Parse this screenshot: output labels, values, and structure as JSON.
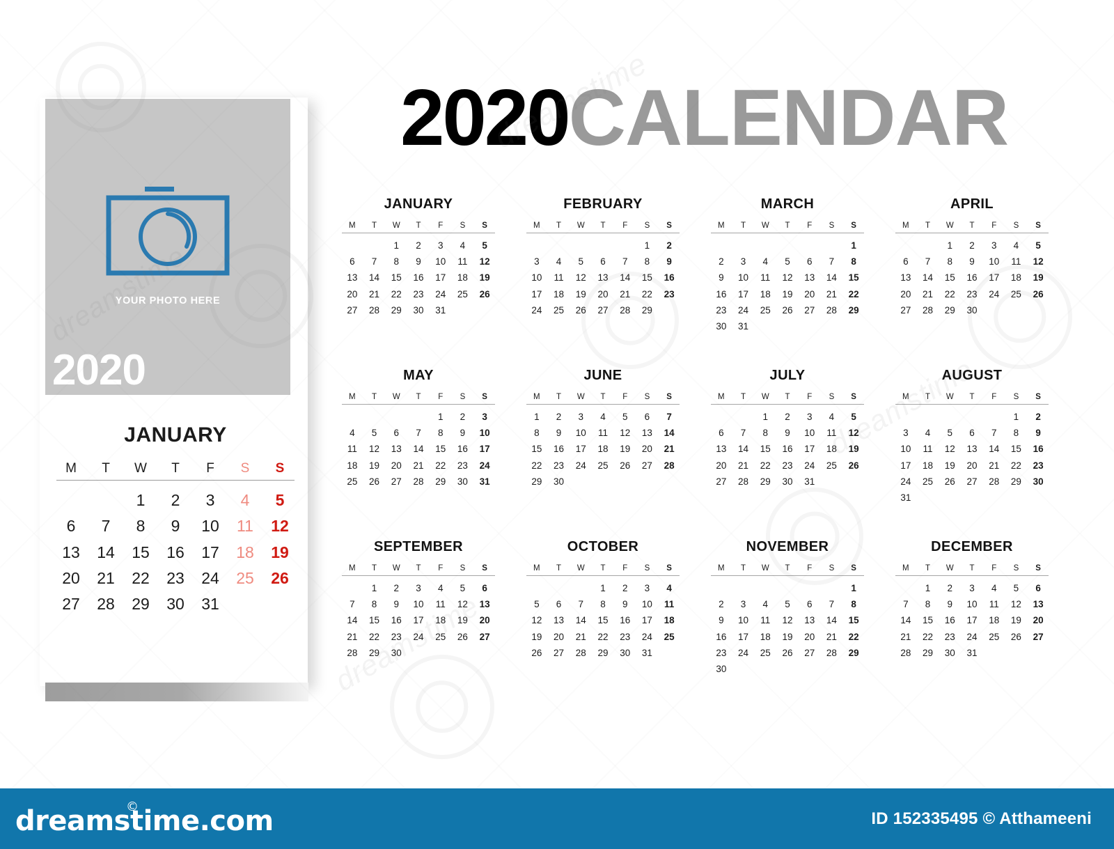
{
  "title": {
    "year": "2020",
    "word": "CALENDAR"
  },
  "photo_card": {
    "caption": "YOUR PHOTO HERE",
    "year": "2020",
    "icon": "camera-icon",
    "icon_color": "#2a7ab0",
    "photo_bg": "#c6c6c6"
  },
  "featured_month": {
    "name": "JANUARY",
    "dow": [
      "M",
      "T",
      "W",
      "T",
      "F",
      "S",
      "S"
    ],
    "weeks": [
      [
        "",
        "",
        "1",
        "2",
        "3",
        "4",
        "5"
      ],
      [
        "6",
        "7",
        "8",
        "9",
        "10",
        "11",
        "12"
      ],
      [
        "13",
        "14",
        "15",
        "16",
        "17",
        "18",
        "19"
      ],
      [
        "20",
        "21",
        "22",
        "23",
        "24",
        "25",
        "26"
      ],
      [
        "27",
        "28",
        "29",
        "30",
        "31",
        "",
        ""
      ]
    ]
  },
  "dow": [
    "M",
    "T",
    "W",
    "T",
    "F",
    "S",
    "S"
  ],
  "colors": {
    "saturday": "#ef8b80",
    "sunday": "#d01a12",
    "weekday": "#1b1b1b",
    "title_accent": "#9a9a9a",
    "footer_bg": "#1176ab"
  },
  "months": [
    {
      "name": "JANUARY",
      "weeks": [
        [
          "",
          "",
          "1",
          "2",
          "3",
          "4",
          "5"
        ],
        [
          "6",
          "7",
          "8",
          "9",
          "10",
          "11",
          "12"
        ],
        [
          "13",
          "14",
          "15",
          "16",
          "17",
          "18",
          "19"
        ],
        [
          "20",
          "21",
          "22",
          "23",
          "24",
          "25",
          "26"
        ],
        [
          "27",
          "28",
          "29",
          "30",
          "31",
          "",
          ""
        ]
      ]
    },
    {
      "name": "FEBRUARY",
      "weeks": [
        [
          "",
          "",
          "",
          "",
          "",
          "1",
          "2"
        ],
        [
          "3",
          "4",
          "5",
          "6",
          "7",
          "8",
          "9"
        ],
        [
          "10",
          "11",
          "12",
          "13",
          "14",
          "15",
          "16"
        ],
        [
          "17",
          "18",
          "19",
          "20",
          "21",
          "22",
          "23"
        ],
        [
          "24",
          "25",
          "26",
          "27",
          "28",
          "29",
          ""
        ]
      ]
    },
    {
      "name": "MARCH",
      "weeks": [
        [
          "",
          "",
          "",
          "",
          "",
          "",
          "1"
        ],
        [
          "2",
          "3",
          "4",
          "5",
          "6",
          "7",
          "8"
        ],
        [
          "9",
          "10",
          "11",
          "12",
          "13",
          "14",
          "15"
        ],
        [
          "16",
          "17",
          "18",
          "19",
          "20",
          "21",
          "22"
        ],
        [
          "23",
          "24",
          "25",
          "26",
          "27",
          "28",
          "29"
        ],
        [
          "30",
          "31",
          "",
          "",
          "",
          "",
          ""
        ]
      ]
    },
    {
      "name": "APRIL",
      "weeks": [
        [
          "",
          "",
          "1",
          "2",
          "3",
          "4",
          "5"
        ],
        [
          "6",
          "7",
          "8",
          "9",
          "10",
          "11",
          "12"
        ],
        [
          "13",
          "14",
          "15",
          "16",
          "17",
          "18",
          "19"
        ],
        [
          "20",
          "21",
          "22",
          "23",
          "24",
          "25",
          "26"
        ],
        [
          "27",
          "28",
          "29",
          "30",
          "",
          "",
          ""
        ]
      ]
    },
    {
      "name": "MAY",
      "weeks": [
        [
          "",
          "",
          "",
          "",
          "1",
          "2",
          "3"
        ],
        [
          "4",
          "5",
          "6",
          "7",
          "8",
          "9",
          "10"
        ],
        [
          "11",
          "12",
          "13",
          "14",
          "15",
          "16",
          "17"
        ],
        [
          "18",
          "19",
          "20",
          "21",
          "22",
          "23",
          "24"
        ],
        [
          "25",
          "26",
          "27",
          "28",
          "29",
          "30",
          "31"
        ]
      ]
    },
    {
      "name": "JUNE",
      "weeks": [
        [
          "1",
          "2",
          "3",
          "4",
          "5",
          "6",
          "7"
        ],
        [
          "8",
          "9",
          "10",
          "11",
          "12",
          "13",
          "14"
        ],
        [
          "15",
          "16",
          "17",
          "18",
          "19",
          "20",
          "21"
        ],
        [
          "22",
          "23",
          "24",
          "25",
          "26",
          "27",
          "28"
        ],
        [
          "29",
          "30",
          "",
          "",
          "",
          "",
          ""
        ]
      ]
    },
    {
      "name": "JULY",
      "weeks": [
        [
          "",
          "",
          "1",
          "2",
          "3",
          "4",
          "5"
        ],
        [
          "6",
          "7",
          "8",
          "9",
          "10",
          "11",
          "12"
        ],
        [
          "13",
          "14",
          "15",
          "16",
          "17",
          "18",
          "19"
        ],
        [
          "20",
          "21",
          "22",
          "23",
          "24",
          "25",
          "26"
        ],
        [
          "27",
          "28",
          "29",
          "30",
          "31",
          "",
          ""
        ]
      ]
    },
    {
      "name": "AUGUST",
      "weeks": [
        [
          "",
          "",
          "",
          "",
          "",
          "1",
          "2"
        ],
        [
          "3",
          "4",
          "5",
          "6",
          "7",
          "8",
          "9"
        ],
        [
          "10",
          "11",
          "12",
          "13",
          "14",
          "15",
          "16"
        ],
        [
          "17",
          "18",
          "19",
          "20",
          "21",
          "22",
          "23"
        ],
        [
          "24",
          "25",
          "26",
          "27",
          "28",
          "29",
          "30"
        ],
        [
          "31",
          "",
          "",
          "",
          "",
          "",
          ""
        ]
      ]
    },
    {
      "name": "SEPTEMBER",
      "weeks": [
        [
          "",
          "1",
          "2",
          "3",
          "4",
          "5",
          "6"
        ],
        [
          "7",
          "8",
          "9",
          "10",
          "11",
          "12",
          "13"
        ],
        [
          "14",
          "15",
          "16",
          "17",
          "18",
          "19",
          "20"
        ],
        [
          "21",
          "22",
          "23",
          "24",
          "25",
          "26",
          "27"
        ],
        [
          "28",
          "29",
          "30",
          "",
          "",
          "",
          ""
        ]
      ]
    },
    {
      "name": "OCTOBER",
      "weeks": [
        [
          "",
          "",
          "",
          "1",
          "2",
          "3",
          "4"
        ],
        [
          "5",
          "6",
          "7",
          "8",
          "9",
          "10",
          "11"
        ],
        [
          "12",
          "13",
          "14",
          "15",
          "16",
          "17",
          "18"
        ],
        [
          "19",
          "20",
          "21",
          "22",
          "23",
          "24",
          "25"
        ],
        [
          "26",
          "27",
          "28",
          "29",
          "30",
          "31",
          ""
        ]
      ]
    },
    {
      "name": "NOVEMBER",
      "weeks": [
        [
          "",
          "",
          "",
          "",
          "",
          "",
          "1"
        ],
        [
          "2",
          "3",
          "4",
          "5",
          "6",
          "7",
          "8"
        ],
        [
          "9",
          "10",
          "11",
          "12",
          "13",
          "14",
          "15"
        ],
        [
          "16",
          "17",
          "18",
          "19",
          "20",
          "21",
          "22"
        ],
        [
          "23",
          "24",
          "25",
          "26",
          "27",
          "28",
          "29"
        ],
        [
          "30",
          "",
          "",
          "",
          "",
          "",
          ""
        ]
      ]
    },
    {
      "name": "DECEMBER",
      "weeks": [
        [
          "",
          "1",
          "2",
          "3",
          "4",
          "5",
          "6"
        ],
        [
          "7",
          "8",
          "9",
          "10",
          "11",
          "12",
          "13"
        ],
        [
          "14",
          "15",
          "16",
          "17",
          "18",
          "19",
          "20"
        ],
        [
          "21",
          "22",
          "23",
          "24",
          "25",
          "26",
          "27"
        ],
        [
          "28",
          "29",
          "30",
          "31",
          "",
          "",
          ""
        ]
      ]
    }
  ],
  "footer": {
    "logo": "dreamstime.com",
    "registered_mark": "©",
    "credit": "ID 152335495 © Atthameeni"
  },
  "watermarks": [
    "dreamstime",
    "dreamstime",
    "dreamstime",
    "dreamstime",
    "dreamstime",
    "dreamstime"
  ]
}
